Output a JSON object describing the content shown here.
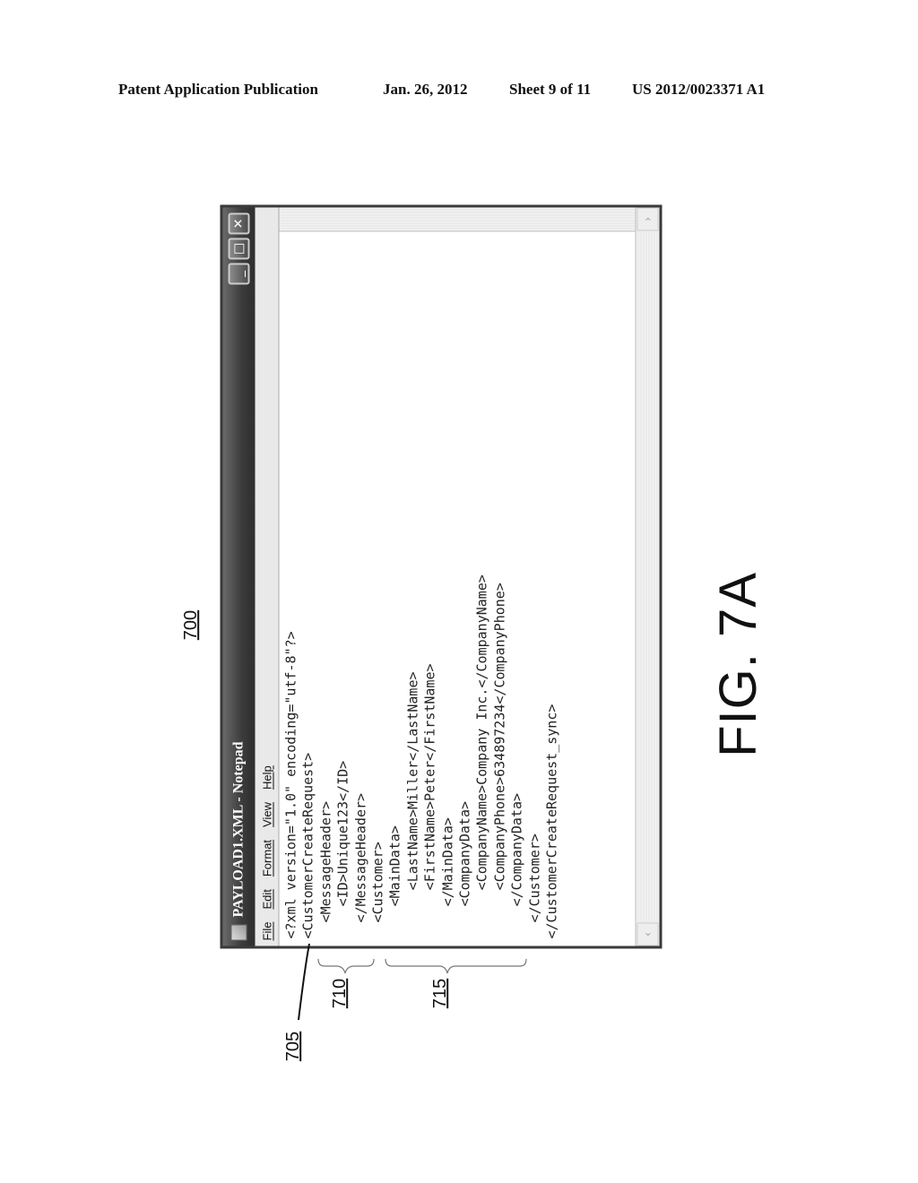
{
  "header": {
    "publication": "Patent Application Publication",
    "date": "Jan. 26, 2012",
    "sheet": "Sheet 9 of 11",
    "number": "US 2012/0023371 A1"
  },
  "figure": {
    "label": "FIG. 7A",
    "references": {
      "window": "700",
      "first_line": "705",
      "message_header": "710",
      "customer": "715"
    }
  },
  "window": {
    "title": "PAYLOAD1.XML - Notepad",
    "controls": {
      "minimize": "_",
      "maximize": "□",
      "close": "✕"
    },
    "menu": [
      "File",
      "Edit",
      "Format",
      "View",
      "Help"
    ],
    "content_lines": [
      "<?xml version=\"1.0\" encoding=\"utf-8\"?>",
      "<CustomerCreateRequest>",
      "  <MessageHeader>",
      "    <ID>Unique123</ID>",
      "  </MessageHeader>",
      "  <Customer>",
      "    <MainData>",
      "      <LastName>Miller</LastName>",
      "      <FirstName>Peter</FirstName>",
      "    </MainData>",
      "    <CompanyData>",
      "      <CompanyName>Company Inc.</CompanyName>",
      "      <CompanyPhone>634897234</CompanyPhone>",
      "    </CompanyData>",
      "  </Customer>",
      "</CustomerCreateRequest_sync>"
    ],
    "scroll_left": "‹",
    "scroll_right": "›"
  }
}
